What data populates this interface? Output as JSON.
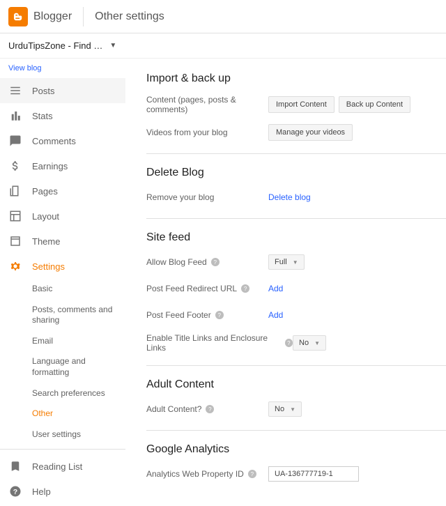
{
  "header": {
    "brand": "Blogger",
    "title": "Other settings"
  },
  "blog": {
    "name": "UrduTipsZone - Find …",
    "view_link": "View blog"
  },
  "nav": {
    "posts": "Posts",
    "stats": "Stats",
    "comments": "Comments",
    "earnings": "Earnings",
    "pages": "Pages",
    "layout": "Layout",
    "theme": "Theme",
    "settings": "Settings",
    "reading_list": "Reading List",
    "help": "Help"
  },
  "settings_sub": {
    "basic": "Basic",
    "posts_comments": "Posts, comments and sharing",
    "email": "Email",
    "language": "Language and formatting",
    "search_prefs": "Search preferences",
    "other": "Other",
    "user_settings": "User settings"
  },
  "content": {
    "import_backup": {
      "title": "Import & back up",
      "content_label": "Content (pages, posts & comments)",
      "import_btn": "Import Content",
      "backup_btn": "Back up Content",
      "videos_label": "Videos from your blog",
      "videos_btn": "Manage your videos"
    },
    "delete": {
      "title": "Delete Blog",
      "label": "Remove your blog",
      "link": "Delete blog"
    },
    "site_feed": {
      "title": "Site feed",
      "allow_label": "Allow Blog Feed",
      "allow_value": "Full",
      "redirect_label": "Post Feed Redirect URL",
      "redirect_link": "Add",
      "footer_label": "Post Feed Footer",
      "footer_link": "Add",
      "enclosure_label": "Enable Title Links and Enclosure Links",
      "enclosure_value": "No"
    },
    "adult": {
      "title": "Adult Content",
      "label": "Adult Content?",
      "value": "No"
    },
    "analytics": {
      "title": "Google Analytics",
      "label": "Analytics Web Property ID",
      "value": "UA-136777719-1"
    }
  }
}
